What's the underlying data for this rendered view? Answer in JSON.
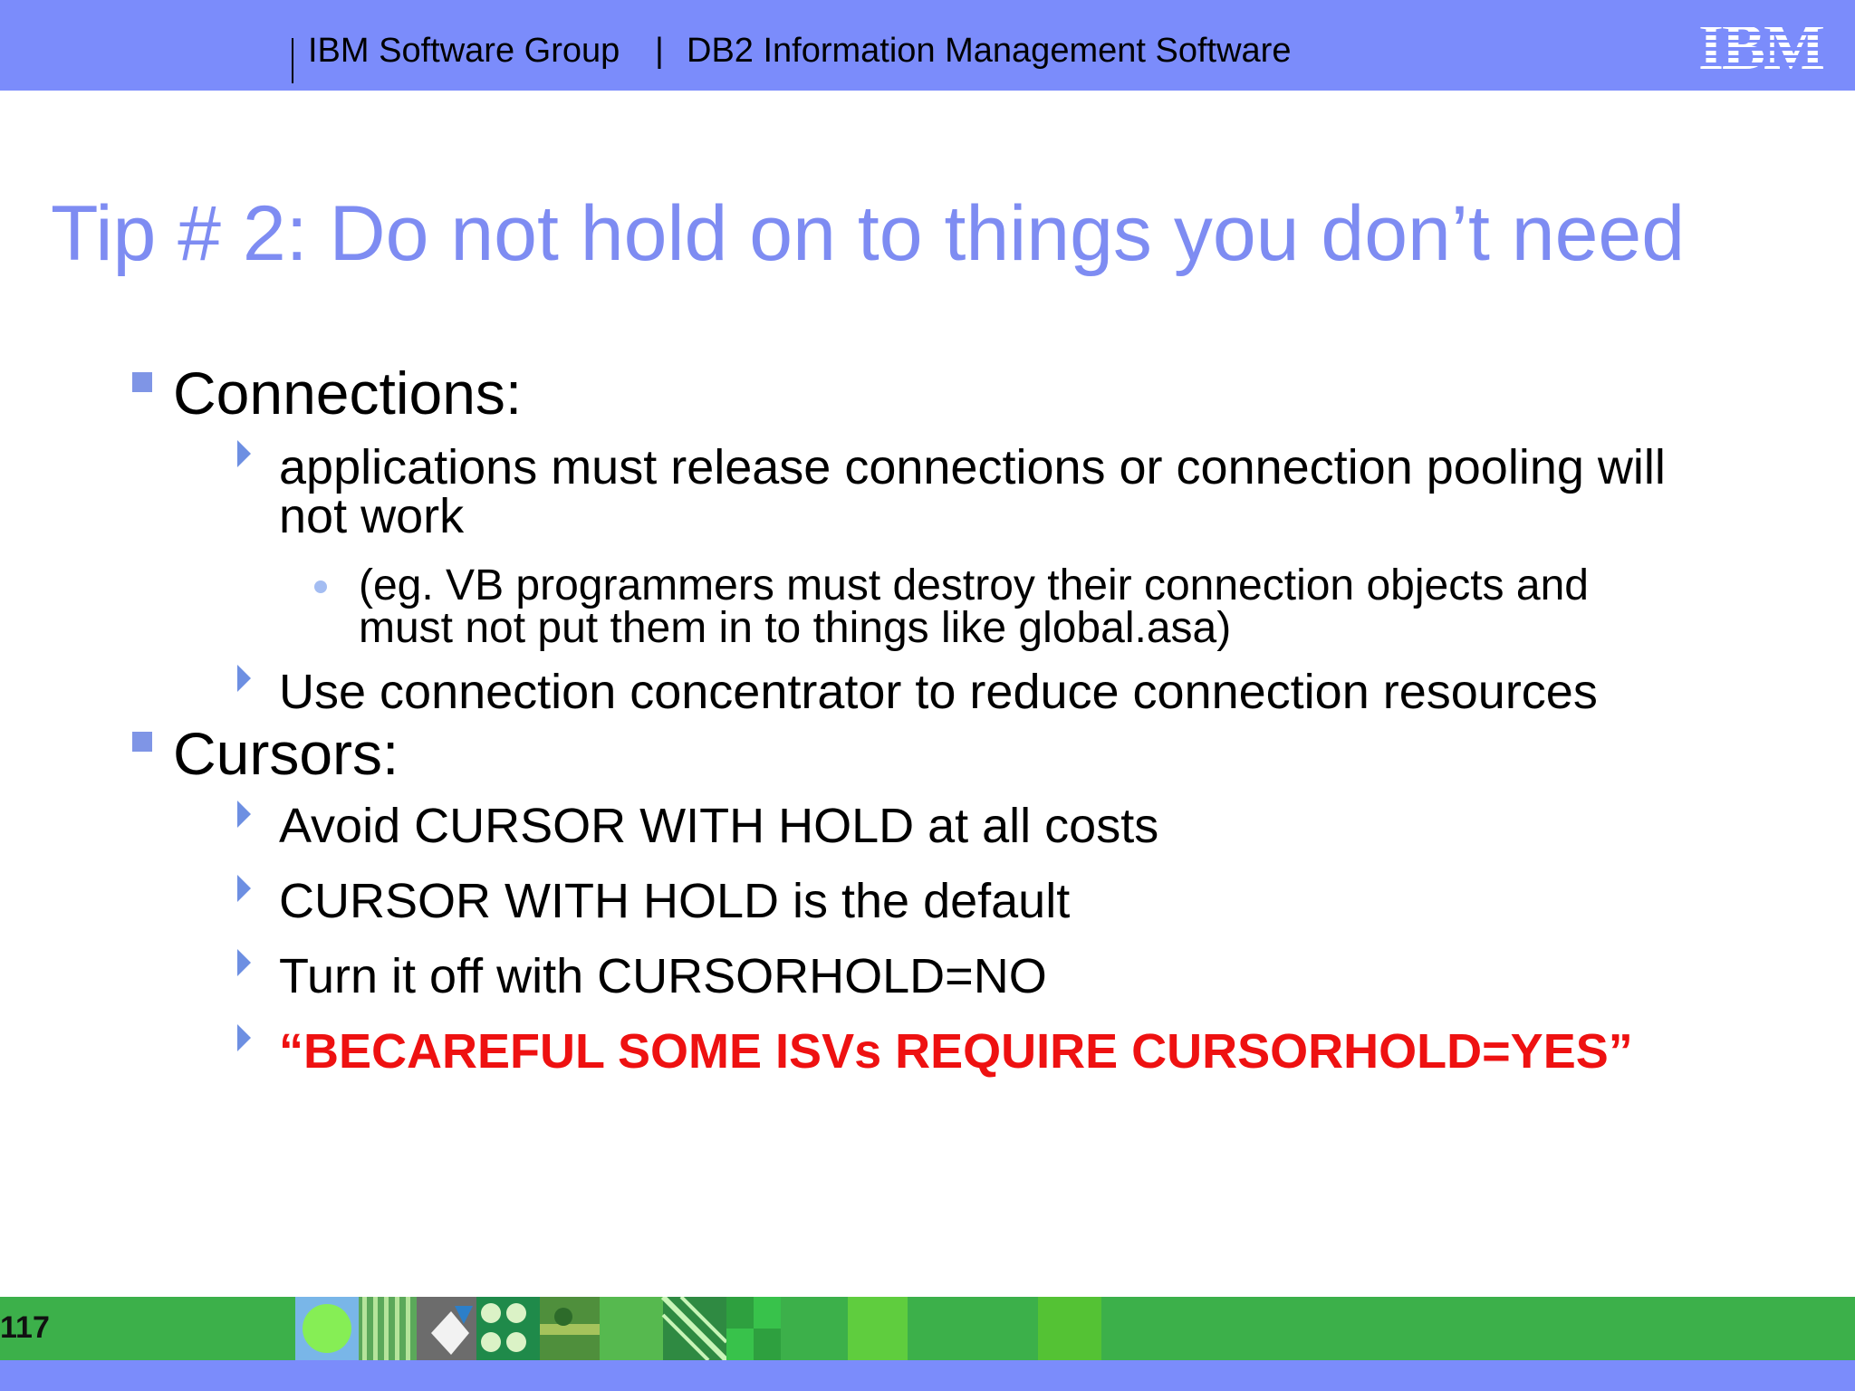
{
  "header": {
    "group": "IBM Software Group",
    "separator": "|",
    "product": "DB2 Information Management Software",
    "logo_text": "IBM",
    "color": "#7b8cfb"
  },
  "slide": {
    "title": "Tip # 2: Do not hold on to things you don’t need",
    "title_color": "#7e8cf2",
    "sections": [
      {
        "label": "Connections:",
        "items": [
          {
            "lines": [
              "applications must release connections or connection pooling will",
              "not work"
            ],
            "sub_lines": [
              "(eg. VB programmers must destroy their connection objects and",
              "must not put them in to things like global.asa)"
            ]
          },
          {
            "text": "Use connection concentrator to reduce connection resources"
          }
        ]
      },
      {
        "label": "Cursors:",
        "items": [
          {
            "text": "Avoid CURSOR WITH HOLD at all costs"
          },
          {
            "text": "CURSOR WITH HOLD is the default"
          },
          {
            "text": "Turn it off with CURSORHOLD=NO"
          },
          {
            "text": "“BECAREFUL SOME ISVs REQUIRE CURSORHOLD=YES”",
            "color": "#ee1111"
          }
        ]
      }
    ]
  },
  "footer": {
    "page_number": "117",
    "strip_color": "#3cb04a"
  }
}
